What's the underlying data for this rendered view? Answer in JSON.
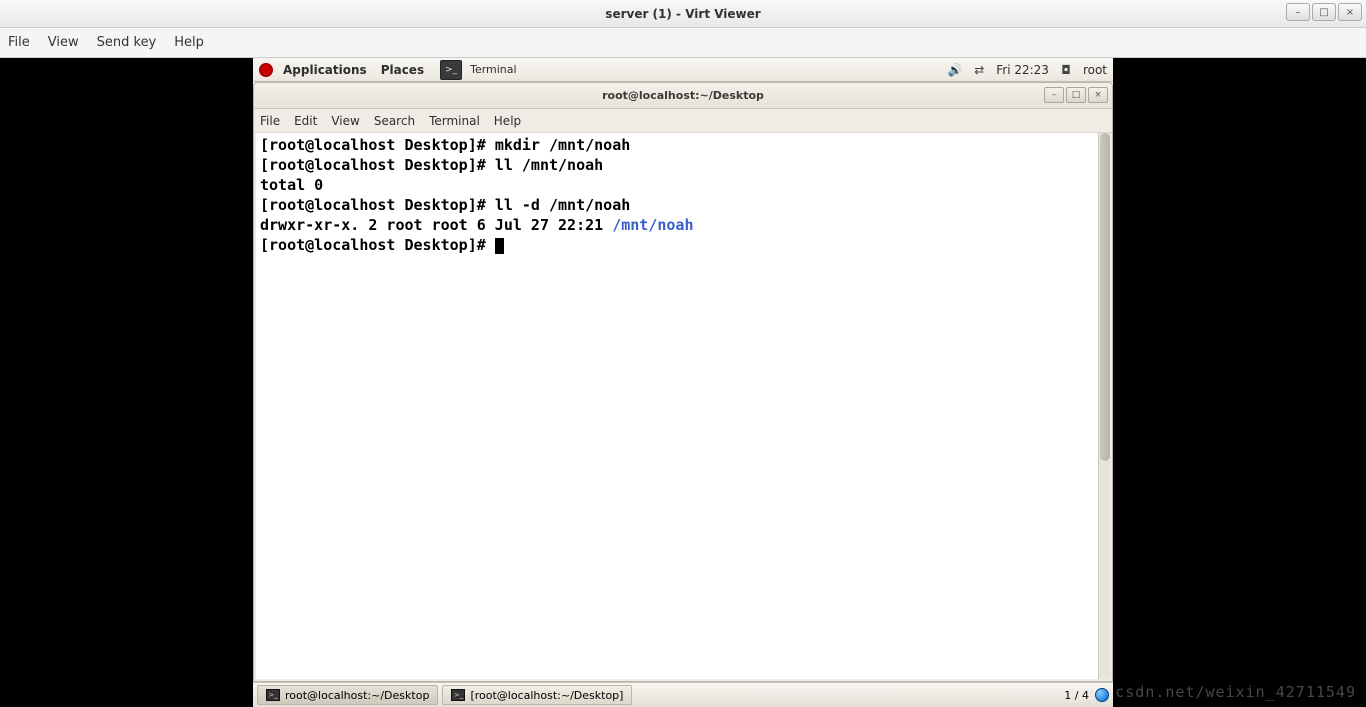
{
  "outer": {
    "title": "server (1) - Virt Viewer",
    "menu": {
      "file": "File",
      "view": "View",
      "sendkey": "Send key",
      "help": "Help"
    }
  },
  "panel": {
    "applications": "Applications",
    "places": "Places",
    "terminal": "Terminal",
    "clock": "Fri 22:23",
    "user": "root"
  },
  "termwin": {
    "title": "root@localhost:~/Desktop",
    "menu": {
      "file": "File",
      "edit": "Edit",
      "view": "View",
      "search": "Search",
      "terminal": "Terminal",
      "help": "Help"
    }
  },
  "terminal": {
    "lines": [
      {
        "prompt": "[root@localhost Desktop]# ",
        "cmd": "mkdir /mnt/noah"
      },
      {
        "prompt": "[root@localhost Desktop]# ",
        "cmd": "ll /mnt/noah"
      },
      {
        "text": "total 0"
      },
      {
        "prompt": "[root@localhost Desktop]# ",
        "cmd": "ll -d /mnt/noah"
      },
      {
        "text": "drwxr-xr-x. 2 root root 6 Jul 27 22:21 ",
        "path": "/mnt/noah"
      },
      {
        "prompt": "[root@localhost Desktop]# ",
        "cursor": true
      }
    ]
  },
  "taskbar": {
    "items": [
      {
        "label": "root@localhost:~/Desktop",
        "active": true
      },
      {
        "label": "[root@localhost:~/Desktop]",
        "active": false
      }
    ],
    "workspace": "1 / 4"
  },
  "watermark": "csdn.net/weixin_42711549"
}
